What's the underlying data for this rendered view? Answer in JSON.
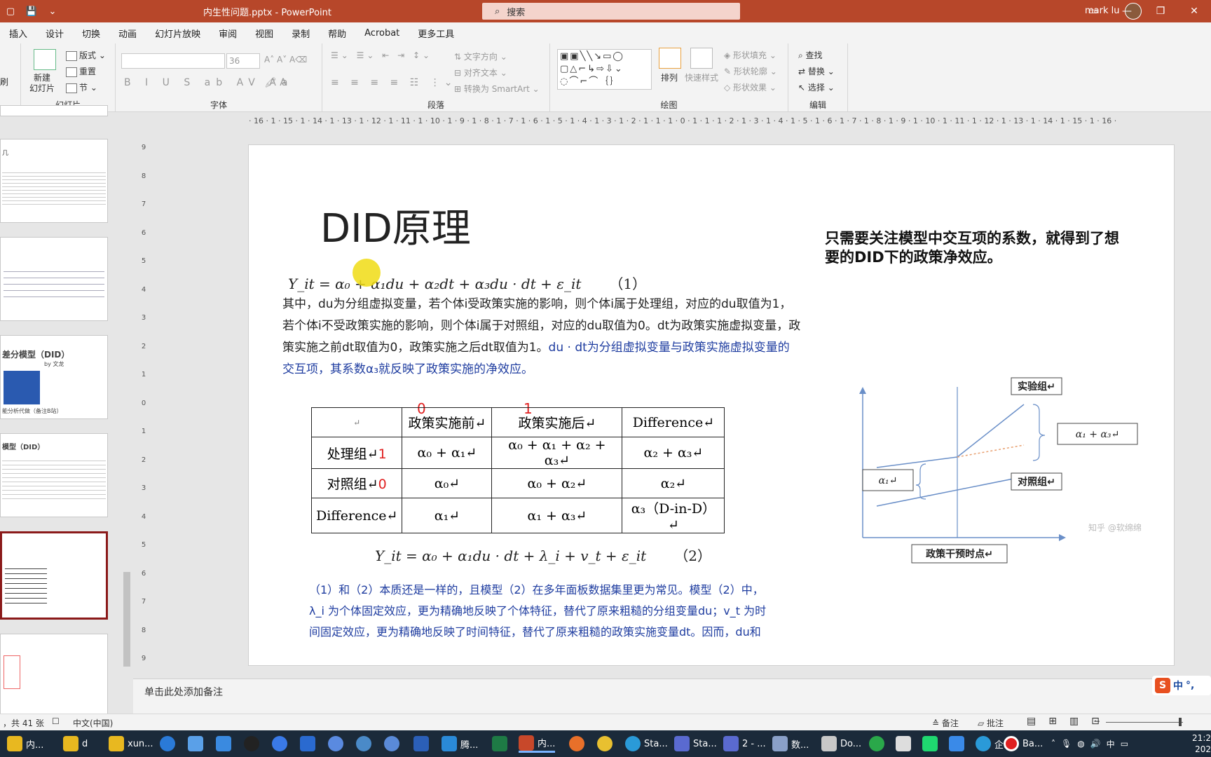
{
  "titlebar": {
    "doc_title": "内生性问题.pptx - PowerPoint",
    "search_placeholder": "搜索",
    "user": "mark lu",
    "save_icon": "save-icon",
    "minimize": "—",
    "restore": "❐",
    "close": "✕"
  },
  "menu": [
    "插入",
    "设计",
    "切换",
    "动画",
    "幻灯片放映",
    "审阅",
    "视图",
    "录制",
    "帮助",
    "Acrobat",
    "更多工具"
  ],
  "ribbon": {
    "slides_group": "幻灯片",
    "new_slide": "新建\n幻灯片",
    "layout": "版式",
    "reset": "重置",
    "section": "节",
    "font_group": "字体",
    "font_size": "36",
    "paragraph_group": "段落",
    "text_direction": "文字方向",
    "align_text": "对齐文本",
    "convert_smartart": "转换为 SmartArt",
    "drawing_group": "绘图",
    "arrange": "排列",
    "quick_styles": "快速样式",
    "shape_fill": "形状填充",
    "shape_outline": "形状轮廓",
    "shape_effects": "形状效果",
    "editing_group": "编辑",
    "find": "查找",
    "replace": "替换",
    "select": "选择",
    "left_label": "刷"
  },
  "ruler": {
    "marks": "· 16 · 1 · 15 · 1 · 14 · 1 · 13 · 1 · 12 · 1 · 11 · 1 · 10 · 1 · 9 · 1 · 8 · 1 · 7 · 1 · 6 · 1 · 5 · 1 · 4 · 1 · 3 · 1 · 2 · 1 · 1 · 1 · 0 · 1 · 1 · 1 · 2 · 1 · 3 · 1 · 4 · 1 · 5 · 1 · 6 · 1 · 7 · 1 · 8 · 1 · 9 · 1 · 10 · 1 · 11 · 1 · 12 · 1 · 13 · 1 · 14 · 1 · 15 · 1 · 16 ·",
    "vmarks": [
      "9",
      "8",
      "7",
      "6",
      "5",
      "4",
      "3",
      "2",
      "1",
      "0",
      "1",
      "2",
      "3",
      "4",
      "5",
      "6",
      "7",
      "8",
      "9"
    ]
  },
  "thumbnails": {
    "t1_title": "几",
    "t3_title": "差分模型（DID）",
    "t3_by": "by 文龙",
    "t3_note": "能分析代做（备注B站）",
    "t4_title": "模型（DID）"
  },
  "slide": {
    "title": "DID原理",
    "eq1": "Y_it = α₀ + α₁du + α₂dt + α₃du · dt + ε_it",
    "eq1_num": "（1）",
    "para_black": "其中，du为分组虚拟变量，若个体i受政策实施的影响，则个体i属于处理组，对应的du取值为1，若个体i不受政策实施的影响，则个体i属于对照组，对应的du取值为0。dt为政策实施虚拟变量，政策实施之前dt取值为0，政策实施之后dt取值为1。",
    "para_blue": "du · dt为分组虚拟变量与政策实施虚拟变量的交互项，其系数α₃就反映了政策实施的净效应。",
    "right_text": "只需要关注模型中交互项的系数，就得到了想要的DID下的政策净效应。",
    "table": {
      "header": [
        "↵",
        "政策实施前↵",
        "政策实施后↵",
        "Difference↵"
      ],
      "red_top": [
        "0",
        "1"
      ],
      "rows": [
        {
          "label": "处理组↵",
          "red": "1",
          "cells": [
            "α₀ + α₁↵",
            "α₀ + α₁ + α₂ + α₃↵",
            "α₂ + α₃↵"
          ]
        },
        {
          "label": "对照组↵",
          "red": "0",
          "cells": [
            "α₀↵",
            "α₀ + α₂↵",
            "α₂↵"
          ]
        },
        {
          "label": "Difference↵",
          "red": "",
          "cells": [
            "α₁↵",
            "α₁ + α₃↵",
            "α₃（D-in-D）↵"
          ]
        }
      ]
    },
    "eq2": "Y_it = α₀ + α₁du · dt + λ_i + v_t + ε_it",
    "eq2_num": "（2）",
    "bottom_l1a": "（1）和（2）本质还是一样的，且模型（2）在多年面板数据集里更为常见。",
    "bottom_l1b": "模型（2）中，",
    "bottom_l2": "λ_i 为个体固定效应，更为精确地反映了个体特征，替代了原来粗糙的分组变量du；v_t 为时",
    "bottom_l3": "间固定效应，更为精确地反映了时间特征，替代了原来粗糙的政策实施变量dt。因而，du和",
    "diagram": {
      "exp_group": "实验组↵",
      "ctrl_group": "对照组↵",
      "alpha13": "α₁ + α₃↵",
      "alpha1": "α₁↵",
      "policy_time": "政策干预时点↵",
      "watermark": "知乎 @软绵绵"
    }
  },
  "notes": "单击此处添加备注",
  "status": {
    "slide_count": "，共 41 张",
    "lang": "中文(中国)",
    "notes_btn": "备注",
    "comments_btn": "批注"
  },
  "taskbar": {
    "items": [
      "内...",
      "d",
      "xun...",
      "腾...",
      "内...",
      "Sta...",
      "Sta...",
      "2 - ...",
      "数...",
      "Do...",
      "企...",
      "Ba..."
    ],
    "time": "21:2",
    "date": "202",
    "ime": "中"
  },
  "colors": {
    "accent": "#b7472a",
    "slide_blue": "#1f3da0",
    "red": "#e02020"
  }
}
